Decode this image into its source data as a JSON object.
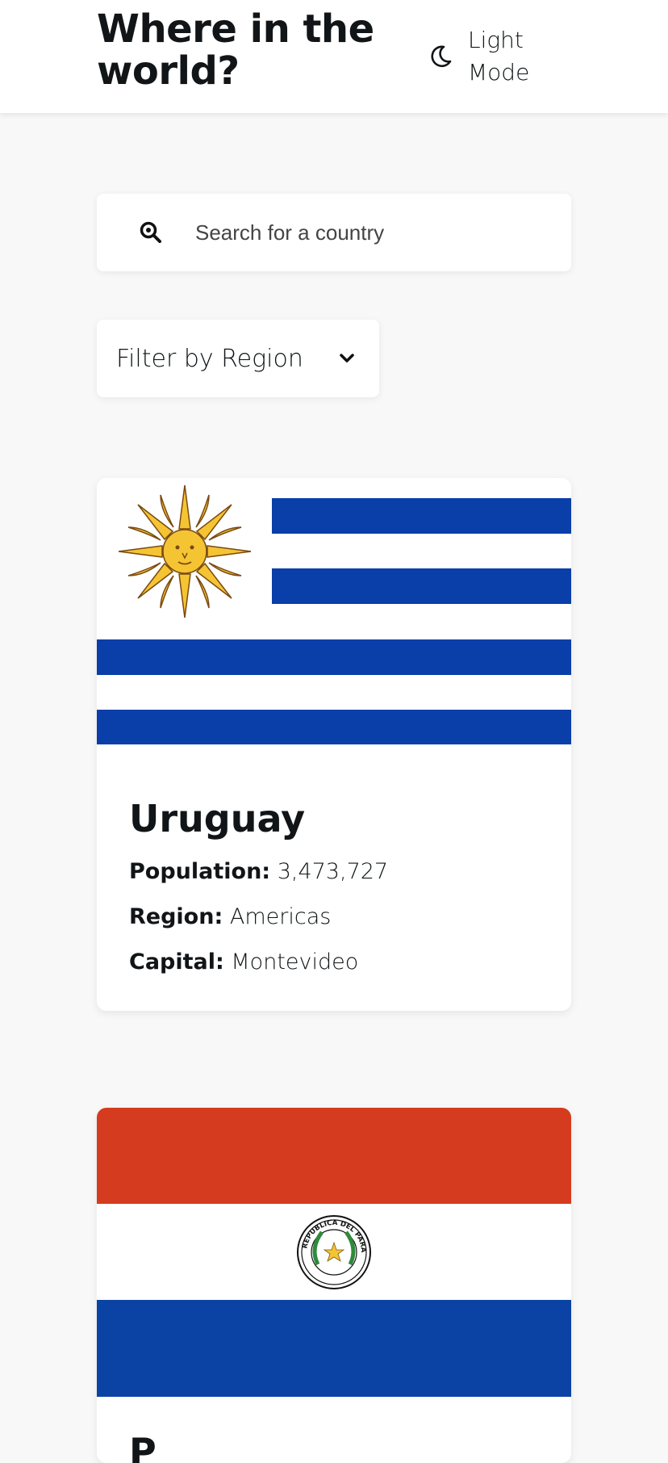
{
  "header": {
    "title": "Where in the world?",
    "theme_label": "Light Mode"
  },
  "search": {
    "placeholder": "Search for a country"
  },
  "filter": {
    "label": "Filter by Region"
  },
  "countries": [
    {
      "name": "Uruguay",
      "population_label": "Population:",
      "population": "3,473,727",
      "region_label": "Region:",
      "region": "Americas",
      "capital_label": "Capital:",
      "capital": "Montevideo",
      "flag_colors": [
        "#0a3ea8",
        "#ffffff",
        "#f5c433"
      ]
    },
    {
      "name": "P",
      "flag_colors": [
        "#d53b1e",
        "#ffffff",
        "#0b43a5"
      ],
      "seal_text": "REPUBLICA DEL PARAGUAY"
    }
  ],
  "colors": {
    "background": "#f8f8f8",
    "card": "#ffffff",
    "text": "#111517"
  }
}
